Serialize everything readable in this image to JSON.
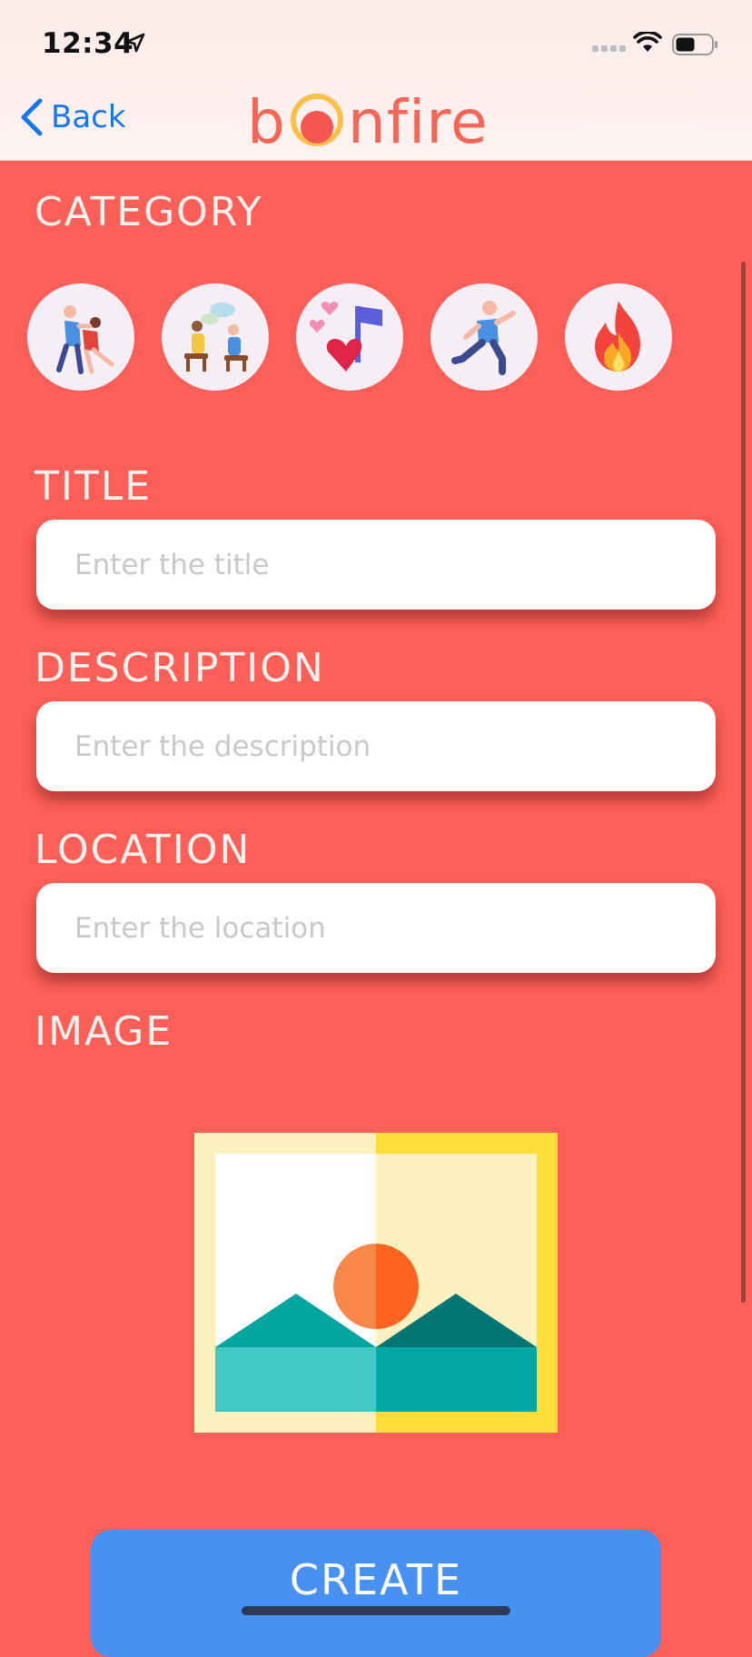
{
  "status_bar": {
    "time": "12:34"
  },
  "nav": {
    "back_label": "Back",
    "logo_prefix": "b",
    "logo_suffix": "nfire"
  },
  "sections": {
    "category": "CATEGORY",
    "title": "TITLE",
    "description": "DESCRIPTION",
    "location": "LOCATION",
    "image": "IMAGE"
  },
  "categories": [
    {
      "icon": "dance-couple-icon"
    },
    {
      "icon": "conversation-people-icon"
    },
    {
      "icon": "music-love-icon"
    },
    {
      "icon": "sport-runner-icon"
    },
    {
      "icon": "fire-icon"
    }
  ],
  "inputs": {
    "title_placeholder": "Enter the title",
    "description_placeholder": "Enter the description",
    "location_placeholder": "Enter the location"
  },
  "create_label": "CREATE",
  "colors": {
    "background": "#FC5F57",
    "header": "#FCEBE8",
    "accent_blue": "#4890F2",
    "logo": "#F56657",
    "back_link": "#1877EF"
  }
}
